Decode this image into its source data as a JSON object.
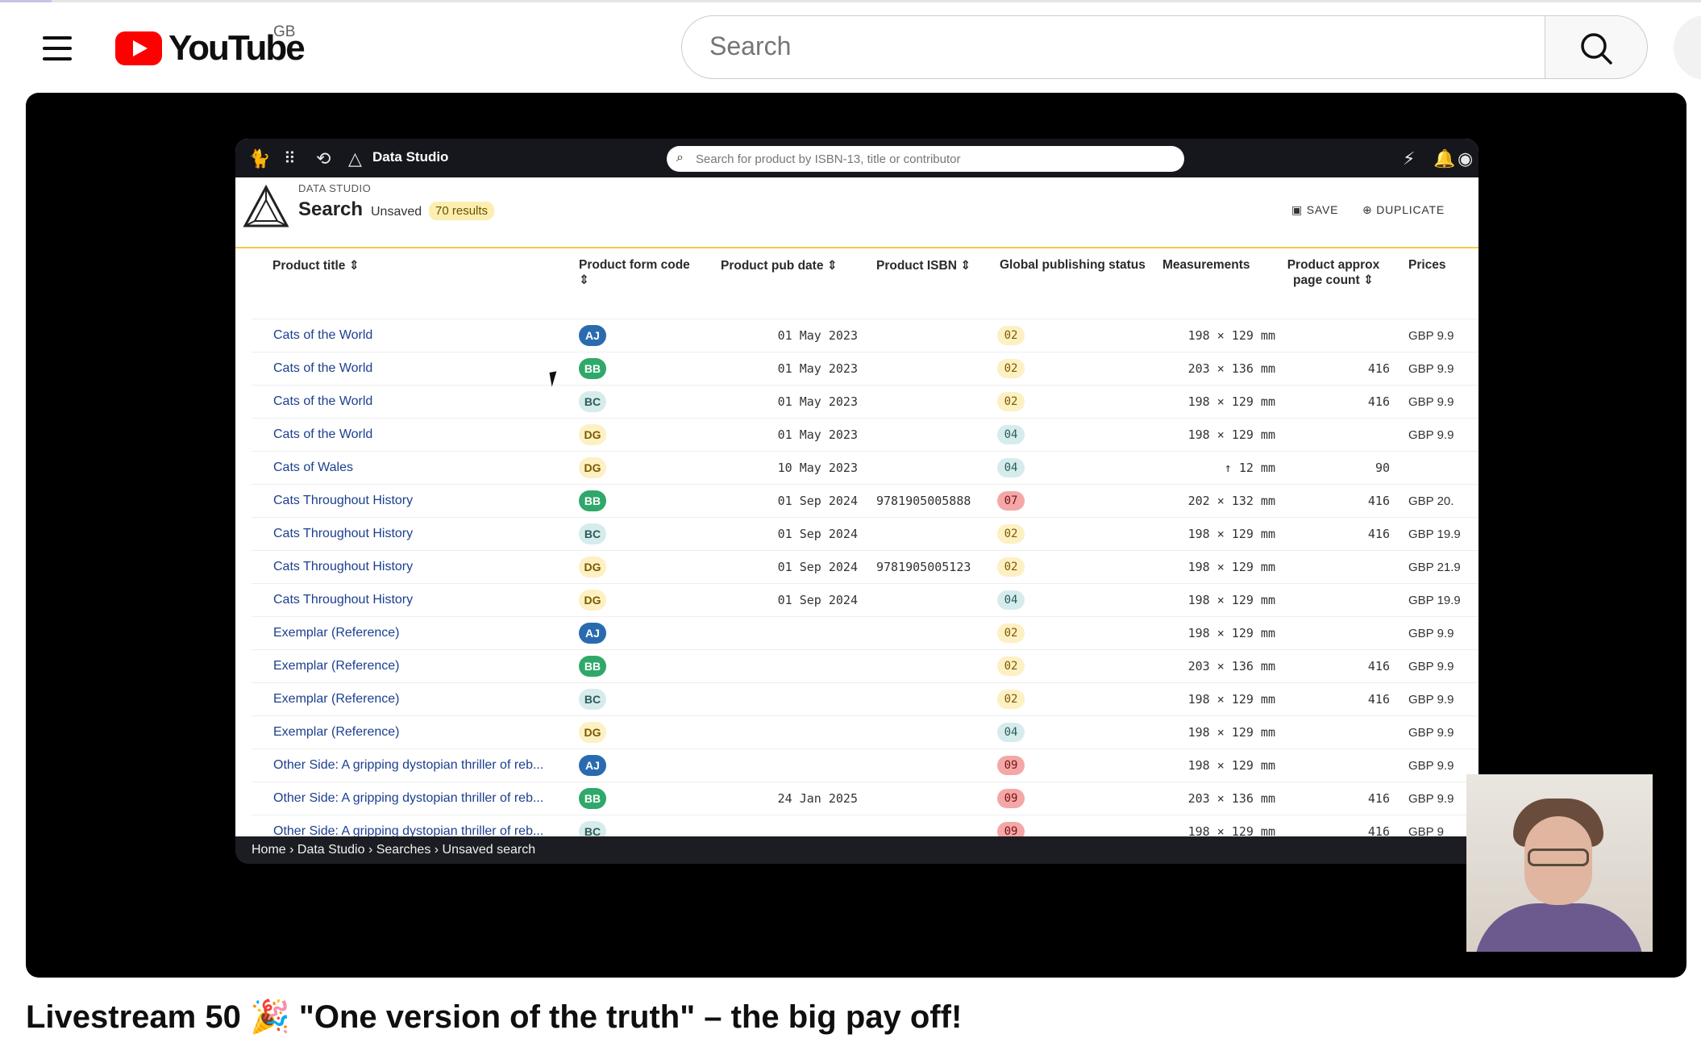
{
  "youtube": {
    "logo_text": "YouTube",
    "country_code": "GB",
    "search_placeholder": "Search",
    "video_title": "Livestream 50 🎉 \"One version of the truth\" – the big pay off!"
  },
  "app": {
    "brand": "Data Studio",
    "search_placeholder": "Search for product by ISBN-13, title or contributor",
    "kicker": "DATA STUDIO",
    "title": "Search",
    "state": "Unsaved",
    "results_badge": "70 results",
    "save_label": "SAVE",
    "duplicate_label": "DUPLICATE",
    "breadcrumb": "Home › Data Studio › Searches › Unsaved search",
    "columns": [
      "Product title",
      "Product form code",
      "Product pub date",
      "Product ISBN",
      "Global publishing status",
      "Measurements",
      "Product approx page count",
      "Prices"
    ],
    "rows": [
      {
        "title": "Cats of the World",
        "form": "AJ",
        "date": "01 May 2023",
        "isbn": "",
        "status": "02",
        "meas": "198 × 129 mm",
        "pages": "",
        "price": "GBP 9.9"
      },
      {
        "title": "Cats of the World",
        "form": "BB",
        "date": "01 May 2023",
        "isbn": "",
        "status": "02",
        "meas": "203 × 136 mm",
        "pages": "416",
        "price": "GBP 9.9"
      },
      {
        "title": "Cats of the World",
        "form": "BC",
        "date": "01 May 2023",
        "isbn": "",
        "status": "02",
        "meas": "198 × 129 mm",
        "pages": "416",
        "price": "GBP 9.9"
      },
      {
        "title": "Cats of the World",
        "form": "DG",
        "date": "01 May 2023",
        "isbn": "",
        "status": "04",
        "meas": "198 × 129 mm",
        "pages": "",
        "price": "GBP 9.9"
      },
      {
        "title": "Cats of Wales",
        "form": "DG",
        "date": "10 May 2023",
        "isbn": "",
        "status": "04",
        "meas": "↑ 12 mm",
        "pages": "90",
        "price": ""
      },
      {
        "title": "Cats Throughout History",
        "form": "BB",
        "date": "01 Sep 2024",
        "isbn": "9781905005888",
        "status": "07",
        "meas": "202 × 132 mm",
        "pages": "416",
        "price": "GBP 20."
      },
      {
        "title": "Cats Throughout History",
        "form": "BC",
        "date": "01 Sep 2024",
        "isbn": "",
        "status": "02",
        "meas": "198 × 129 mm",
        "pages": "416",
        "price": "GBP 19.9"
      },
      {
        "title": "Cats Throughout History",
        "form": "DG",
        "date": "01 Sep 2024",
        "isbn": "9781905005123",
        "status": "02",
        "meas": "198 × 129 mm",
        "pages": "",
        "price": "GBP 21.9"
      },
      {
        "title": "Cats Throughout History",
        "form": "DG",
        "date": "01 Sep 2024",
        "isbn": "",
        "status": "04",
        "meas": "198 × 129 mm",
        "pages": "",
        "price": "GBP 19.9"
      },
      {
        "title": "Exemplar (Reference)",
        "form": "AJ",
        "date": "",
        "isbn": "",
        "status": "02",
        "meas": "198 × 129 mm",
        "pages": "",
        "price": "GBP 9.9"
      },
      {
        "title": "Exemplar (Reference)",
        "form": "BB",
        "date": "",
        "isbn": "",
        "status": "02",
        "meas": "203 × 136 mm",
        "pages": "416",
        "price": "GBP 9.9"
      },
      {
        "title": "Exemplar (Reference)",
        "form": "BC",
        "date": "",
        "isbn": "",
        "status": "02",
        "meas": "198 × 129 mm",
        "pages": "416",
        "price": "GBP 9.9"
      },
      {
        "title": "Exemplar (Reference)",
        "form": "DG",
        "date": "",
        "isbn": "",
        "status": "04",
        "meas": "198 × 129 mm",
        "pages": "",
        "price": "GBP 9.9"
      },
      {
        "title": "Other Side: A gripping dystopian thriller of reb...",
        "form": "AJ",
        "date": "",
        "isbn": "",
        "status": "09",
        "meas": "198 × 129 mm",
        "pages": "",
        "price": "GBP 9.9"
      },
      {
        "title": "Other Side: A gripping dystopian thriller of reb...",
        "form": "BB",
        "date": "24 Jan 2025",
        "isbn": "",
        "status": "09",
        "meas": "203 × 136 mm",
        "pages": "416",
        "price": "GBP 9.9"
      },
      {
        "title": "Other Side: A gripping dystopian thriller of reb...",
        "form": "BC",
        "date": "",
        "isbn": "",
        "status": "09",
        "meas": "198 × 129 mm",
        "pages": "416",
        "price": "GBP 9"
      }
    ]
  },
  "colors": {
    "form": {
      "AJ": [
        "#2a6bb0",
        "#ffffff"
      ],
      "BB": [
        "#2fa86a",
        "#ffffff"
      ],
      "BC": [
        "#d6ecec",
        "#2d5a5a"
      ],
      "DG": [
        "#fdf0c2",
        "#7a5a00"
      ]
    },
    "status": {
      "02": [
        "#fdf0c2",
        "#7a5a00"
      ],
      "04": [
        "#d6ecec",
        "#2d5a5a"
      ],
      "07": [
        "#f4a7a7",
        "#7a1010"
      ],
      "09": [
        "#f4a7a7",
        "#7a1010"
      ]
    }
  }
}
